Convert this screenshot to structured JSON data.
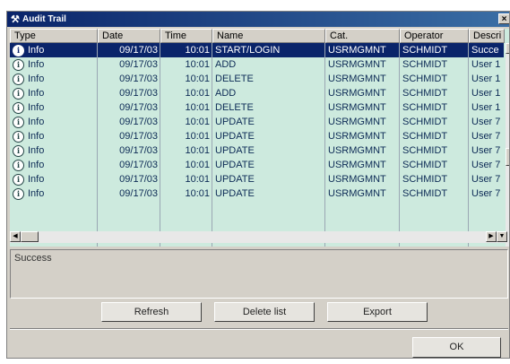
{
  "window": {
    "title": "Audit Trail",
    "close_glyph": "×"
  },
  "columns": [
    "Type",
    "Date",
    "Time",
    "Name",
    "Cat.",
    "Operator",
    "Descri"
  ],
  "rows": [
    {
      "type": "Info",
      "date": "09/17/03",
      "time": "10:01",
      "name": "START/LOGIN",
      "cat": "USRMGMNT",
      "operator": "SCHMIDT",
      "desc": "Succe",
      "selected": true
    },
    {
      "type": "Info",
      "date": "09/17/03",
      "time": "10:01",
      "name": "ADD",
      "cat": "USRMGMNT",
      "operator": "SCHMIDT",
      "desc": "User 1"
    },
    {
      "type": "Info",
      "date": "09/17/03",
      "time": "10:01",
      "name": "DELETE",
      "cat": "USRMGMNT",
      "operator": "SCHMIDT",
      "desc": "User 1"
    },
    {
      "type": "Info",
      "date": "09/17/03",
      "time": "10:01",
      "name": "ADD",
      "cat": "USRMGMNT",
      "operator": "SCHMIDT",
      "desc": "User 1"
    },
    {
      "type": "Info",
      "date": "09/17/03",
      "time": "10:01",
      "name": "DELETE",
      "cat": "USRMGMNT",
      "operator": "SCHMIDT",
      "desc": "User 1"
    },
    {
      "type": "Info",
      "date": "09/17/03",
      "time": "10:01",
      "name": "UPDATE",
      "cat": "USRMGMNT",
      "operator": "SCHMIDT",
      "desc": "User 7"
    },
    {
      "type": "Info",
      "date": "09/17/03",
      "time": "10:01",
      "name": "UPDATE",
      "cat": "USRMGMNT",
      "operator": "SCHMIDT",
      "desc": "User 7"
    },
    {
      "type": "Info",
      "date": "09/17/03",
      "time": "10:01",
      "name": "UPDATE",
      "cat": "USRMGMNT",
      "operator": "SCHMIDT",
      "desc": "User 7"
    },
    {
      "type": "Info",
      "date": "09/17/03",
      "time": "10:01",
      "name": "UPDATE",
      "cat": "USRMGMNT",
      "operator": "SCHMIDT",
      "desc": "User 7"
    },
    {
      "type": "Info",
      "date": "09/17/03",
      "time": "10:01",
      "name": "UPDATE",
      "cat": "USRMGMNT",
      "operator": "SCHMIDT",
      "desc": "User 7"
    },
    {
      "type": "Info",
      "date": "09/17/03",
      "time": "10:01",
      "name": "UPDATE",
      "cat": "USRMGMNT",
      "operator": "SCHMIDT",
      "desc": "User 7"
    }
  ],
  "icons": {
    "row": "info-icon",
    "title": "audit-trail-icon"
  },
  "message": {
    "text": "Success"
  },
  "buttons": {
    "refresh": "Refresh",
    "delete_list": "Delete list",
    "export": "Export",
    "ok": "OK"
  },
  "colors": {
    "selection": "#0a246a",
    "grid_bg": "#cdeade",
    "titlebar": "#0a246a"
  }
}
